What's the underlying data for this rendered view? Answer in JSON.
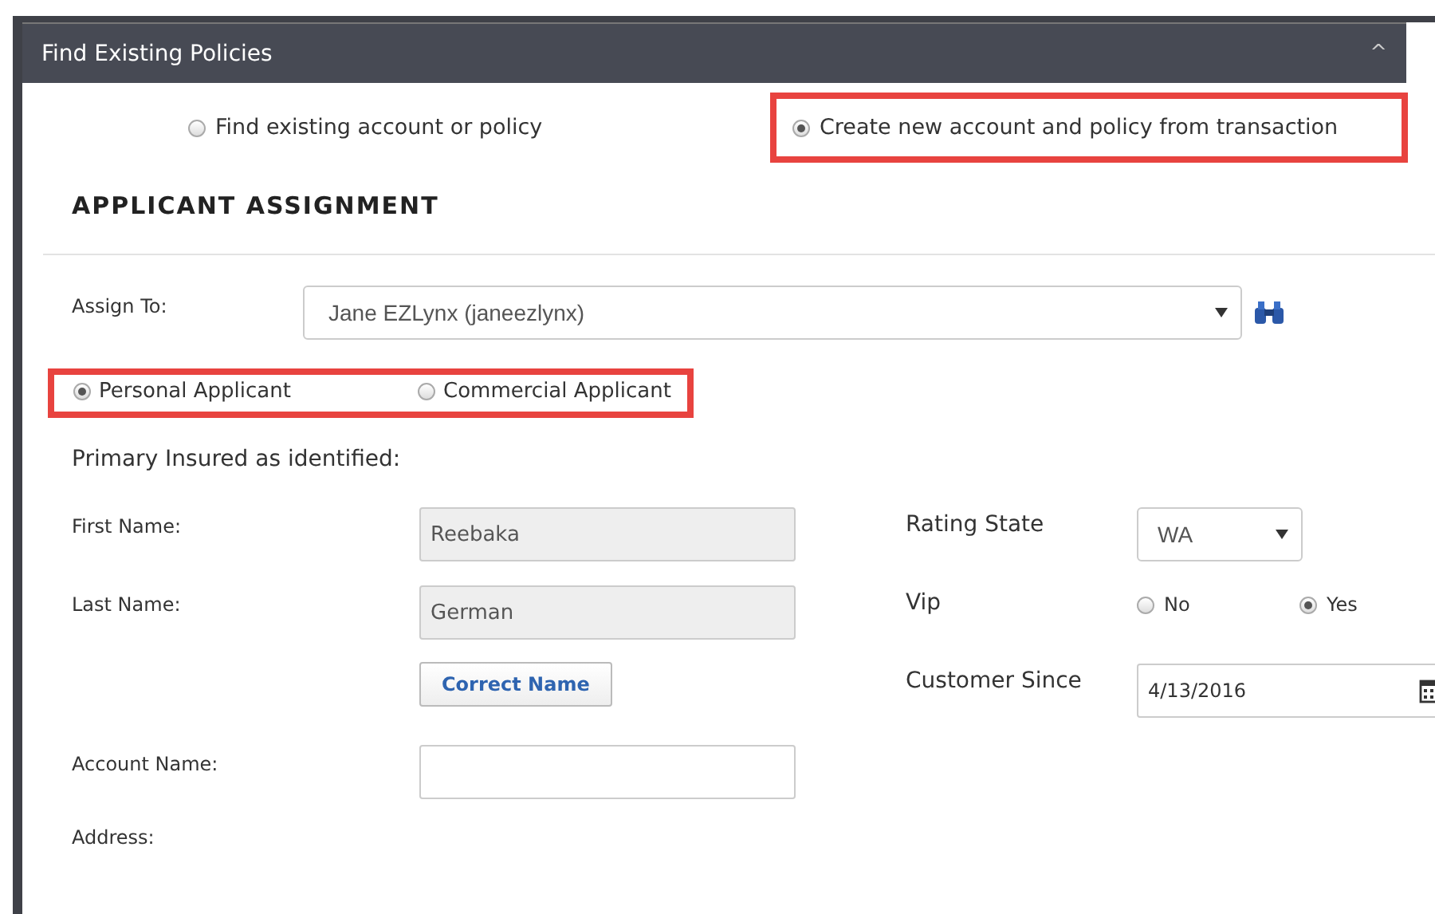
{
  "panel": {
    "title": "Find Existing Policies",
    "collapse_icon": "^"
  },
  "search_mode": {
    "highlighted": true,
    "options": [
      {
        "label": "Find existing account or policy",
        "selected": false
      },
      {
        "label": "Create new account and policy from transaction",
        "selected": true
      }
    ]
  },
  "section_title": "APPLICANT ASSIGNMENT",
  "assign_to": {
    "label": "Assign To:",
    "value": "Jane EZLynx (janeezlynx)"
  },
  "applicant_type": {
    "highlighted": true,
    "options": [
      {
        "label": "Personal Applicant",
        "selected": true
      },
      {
        "label": "Commercial Applicant",
        "selected": false
      }
    ]
  },
  "primary_insured_label": "Primary Insured as identified:",
  "first_name": {
    "label": "First Name:",
    "value": "Reebaka",
    "disabled": true
  },
  "last_name": {
    "label": "Last Name:",
    "value": "German",
    "disabled": true
  },
  "correct_name_button": "Correct Name",
  "rating_state": {
    "label": "Rating State",
    "value": "WA"
  },
  "vip": {
    "label": "Vip",
    "options": [
      {
        "label": "No",
        "selected": false
      },
      {
        "label": "Yes",
        "selected": true
      }
    ]
  },
  "customer_since": {
    "label": "Customer Since",
    "value": "4/13/2016"
  },
  "account_name": {
    "label": "Account Name:"
  },
  "address_label": "Address:"
}
